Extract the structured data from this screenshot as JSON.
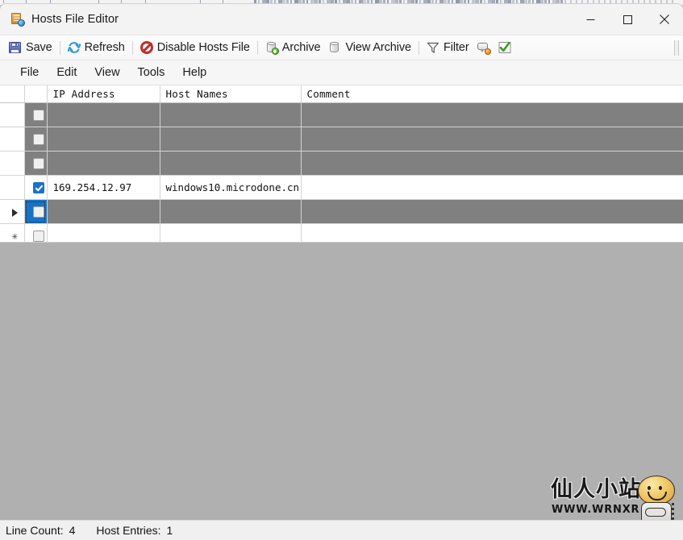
{
  "window": {
    "title": "Hosts File Editor",
    "app_icon": "hosts-file-icon",
    "controls": {
      "minimize": "minimize-button",
      "maximize": "maximize-button",
      "close": "close-button"
    }
  },
  "toolbar": {
    "items": [
      {
        "label": "Save",
        "icon": "save-icon"
      },
      {
        "label": "Refresh",
        "icon": "refresh-icon"
      },
      {
        "label": "Disable Hosts File",
        "icon": "disable-icon"
      },
      {
        "label": "Archive",
        "icon": "archive-add-icon"
      },
      {
        "label": "View Archive",
        "icon": "archive-view-icon"
      },
      {
        "label": "Filter",
        "icon": "filter-icon"
      }
    ],
    "trailing_icons": [
      {
        "icon": "comment-icon"
      },
      {
        "icon": "enabled-check-icon"
      }
    ]
  },
  "menubar": {
    "items": [
      "File",
      "Edit",
      "View",
      "Tools",
      "Help"
    ]
  },
  "grid": {
    "columns": [
      "IP Address",
      "Host Names",
      "Comment"
    ],
    "rows": [
      {
        "checked": false,
        "enabled": false,
        "ip": "",
        "hosts": "",
        "comment": "",
        "marker": "",
        "state": "dim"
      },
      {
        "checked": false,
        "enabled": false,
        "ip": "",
        "hosts": "",
        "comment": "",
        "marker": "",
        "state": "dim"
      },
      {
        "checked": false,
        "enabled": false,
        "ip": "",
        "hosts": "",
        "comment": "",
        "marker": "",
        "state": "dim"
      },
      {
        "checked": true,
        "enabled": true,
        "ip": "169.254.12.97",
        "hosts": "windows10.microdone.cn",
        "comment": "",
        "marker": "",
        "state": "white"
      },
      {
        "checked": false,
        "enabled": false,
        "ip": "",
        "hosts": "",
        "comment": "",
        "marker": "current-row-arrow",
        "state": "dim",
        "selected": true
      },
      {
        "checked": false,
        "enabled": false,
        "ip": "",
        "hosts": "",
        "comment": "",
        "marker": "new-row-asterisk",
        "state": "white"
      }
    ]
  },
  "statusbar": {
    "line_count_label": "Line Count:",
    "line_count_value": "4",
    "host_entries_label": "Host Entries:",
    "host_entries_value": "1"
  },
  "watermark": {
    "cn": "仙人小站",
    "url": "WWW.WRNXR.CN"
  },
  "colors": {
    "accent_blue": "#1673c8",
    "row_dim": "#808080",
    "body_gray": "#b0b0b0",
    "chrome": "#f3f3f3",
    "disable_red": "#c42b2b",
    "check_green": "#3f9c1f"
  }
}
